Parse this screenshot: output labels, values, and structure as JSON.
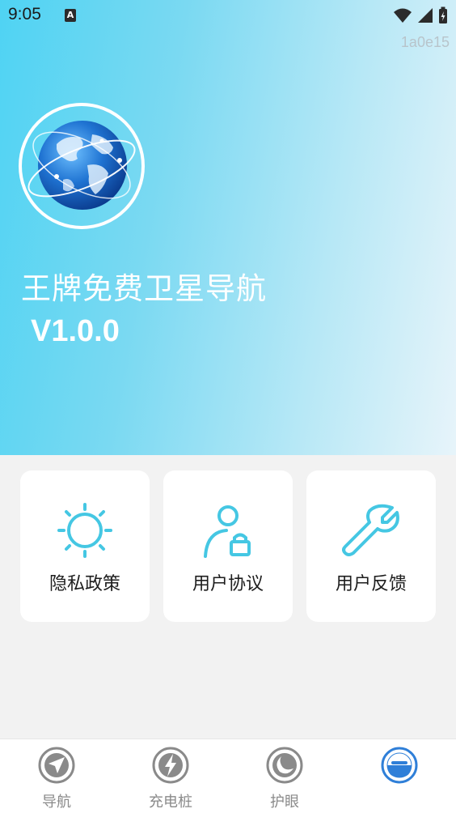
{
  "status_bar": {
    "time": "9:05",
    "notification_icon": "A",
    "icons": [
      "wifi-icon",
      "signal-icon",
      "battery-charging-icon"
    ]
  },
  "watermark": "1a0e15",
  "header": {
    "logo": "globe-icon",
    "app_name": "王牌免费卫星导航",
    "version": "V1.0.0"
  },
  "cards": [
    {
      "label": "隐私政策",
      "icon": "sun-icon"
    },
    {
      "label": "用户协议",
      "icon": "user-lock-icon"
    },
    {
      "label": "用户反馈",
      "icon": "wrench-icon"
    }
  ],
  "bottom_nav": [
    {
      "label": "导航",
      "icon": "navigation-icon",
      "active": false
    },
    {
      "label": "充电桩",
      "icon": "charging-icon",
      "active": false
    },
    {
      "label": "护眼",
      "icon": "eye-care-icon",
      "active": false
    },
    {
      "label": "",
      "icon": "profile-icon",
      "active": true
    }
  ],
  "colors": {
    "accent": "#45c7e3",
    "active_nav": "#2f7fd8",
    "inactive_nav": "#8a8a8a"
  }
}
